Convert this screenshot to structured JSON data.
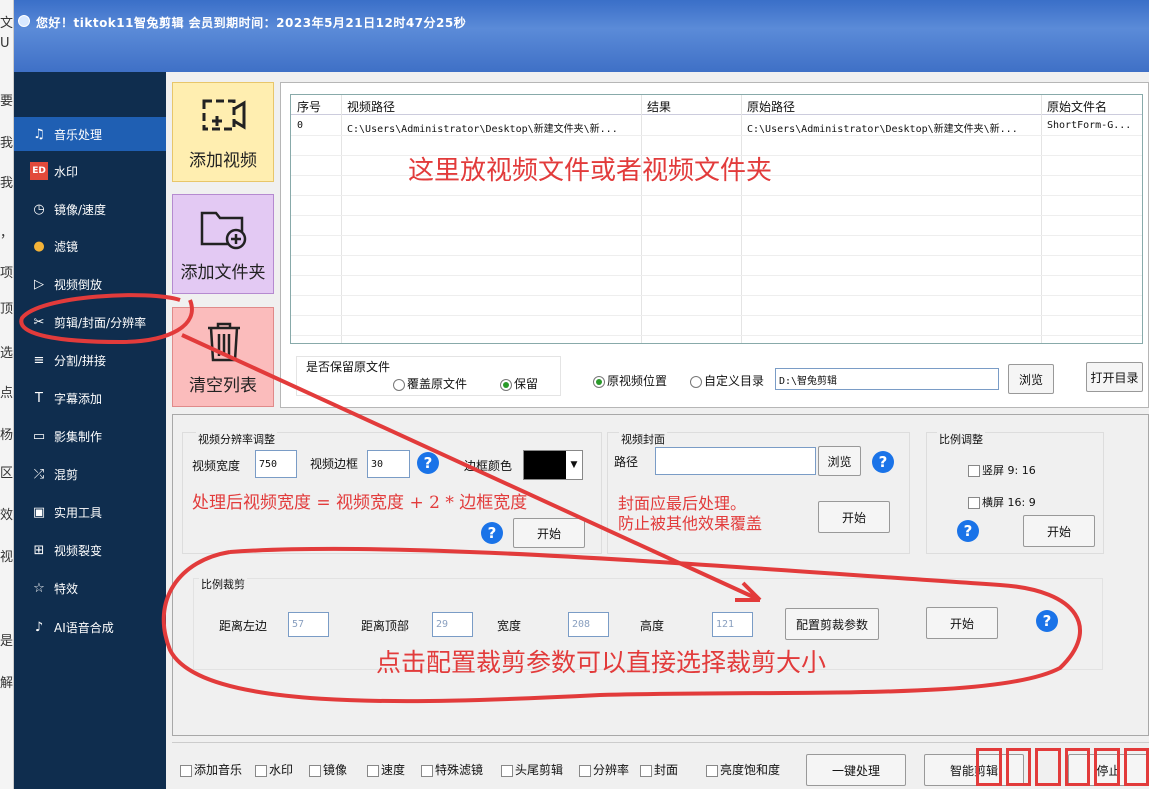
{
  "window": {
    "title": "您好！tiktok11智兔剪辑 会员到期时间：2023年5月21日12时47分25秒"
  },
  "bg_chars": [
    "文",
    "U",
    "要",
    "我",
    "我",
    "，",
    "项",
    "顶",
    "选",
    "点",
    "杨",
    "区",
    "效",
    "视",
    "是",
    "解"
  ],
  "sidebar": {
    "items": [
      {
        "label": "音乐处理",
        "icon": "music-icon"
      },
      {
        "label": "水印",
        "icon": "watermark-icon"
      },
      {
        "label": "镜像/速度",
        "icon": "speed-icon"
      },
      {
        "label": "滤镜",
        "icon": "filter-icon"
      },
      {
        "label": "视频倒放",
        "icon": "reverse-icon"
      },
      {
        "label": "剪辑/封面/分辨率",
        "icon": "scissors-icon"
      },
      {
        "label": "分割/拼接",
        "icon": "split-icon"
      },
      {
        "label": "字幕添加",
        "icon": "subtitle-icon"
      },
      {
        "label": "影集制作",
        "icon": "album-icon"
      },
      {
        "label": "混剪",
        "icon": "shuffle-icon"
      },
      {
        "label": "实用工具",
        "icon": "toolbox-icon"
      },
      {
        "label": "视频裂变",
        "icon": "fission-icon"
      },
      {
        "label": "特效",
        "icon": "effects-icon"
      },
      {
        "label": "AI语音合成",
        "icon": "ai-voice-icon"
      }
    ]
  },
  "actions": {
    "add_video": "添加视频",
    "add_folder": "添加文件夹",
    "clear_list": "清空列表"
  },
  "table": {
    "columns": [
      "序号",
      "视频路径",
      "结果",
      "原始路径",
      "原始文件名"
    ],
    "rows": [
      [
        "0",
        "C:\\Users\\Administrator\\Desktop\\新建文件夹\\新...",
        "",
        "C:\\Users\\Administrator\\Desktop\\新建文件夹\\新...",
        "ShortForm-G..."
      ]
    ],
    "hint": "这里放视频文件或者视频文件夹"
  },
  "keep": {
    "label": "是否保留原文件",
    "overwrite": "覆盖原文件",
    "keep": "保留",
    "original_location": "原视频位置",
    "custom_dir": "自定义目录",
    "dir_value": "D:\\智兔剪辑",
    "browse": "浏览",
    "open_dir": "打开目录"
  },
  "resolution": {
    "title": "视频分辨率调整",
    "width_label": "视频宽度",
    "width_value": "750",
    "border_label": "视频边框",
    "border_value": "30",
    "border_color_label": "边框颜色",
    "border_color": "#000000",
    "note": "处理后视频宽度 = 视频宽度 + 2 * 边框宽度",
    "start": "开始"
  },
  "cover": {
    "title": "视频封面",
    "path_label": "路径",
    "path_value": "",
    "browse": "浏览",
    "note1": "封面应最后处理。",
    "note2": "防止被其他效果覆盖",
    "start": "开始"
  },
  "ratio": {
    "title": "比例调整",
    "portrait": "竖屏 9: 16",
    "landscape": "横屏 16: 9",
    "start": "开始"
  },
  "crop": {
    "title": "比例裁剪",
    "left_label": "距离左边",
    "left_value": "57",
    "top_label": "距离顶部",
    "top_value": "29",
    "width_label": "宽度",
    "width_value": "208",
    "height_label": "高度",
    "height_value": "121",
    "config": "配置剪裁参数",
    "start": "开始",
    "hint": "点击配置裁剪参数可以直接选择裁剪大小"
  },
  "bottom": {
    "options": [
      "添加音乐",
      "水印",
      "镜像",
      "速度",
      "特殊滤镜",
      "头尾剪辑",
      "分辨率",
      "封面",
      "亮度饱和度"
    ],
    "one_click": "一键处理",
    "smart": "智能剪辑",
    "stop": "停止"
  },
  "colors": {
    "accent": "#1f5fb3",
    "sidebar": "#0f2d4e",
    "annotation": "#e23b3b",
    "help": "#1a73e8"
  }
}
